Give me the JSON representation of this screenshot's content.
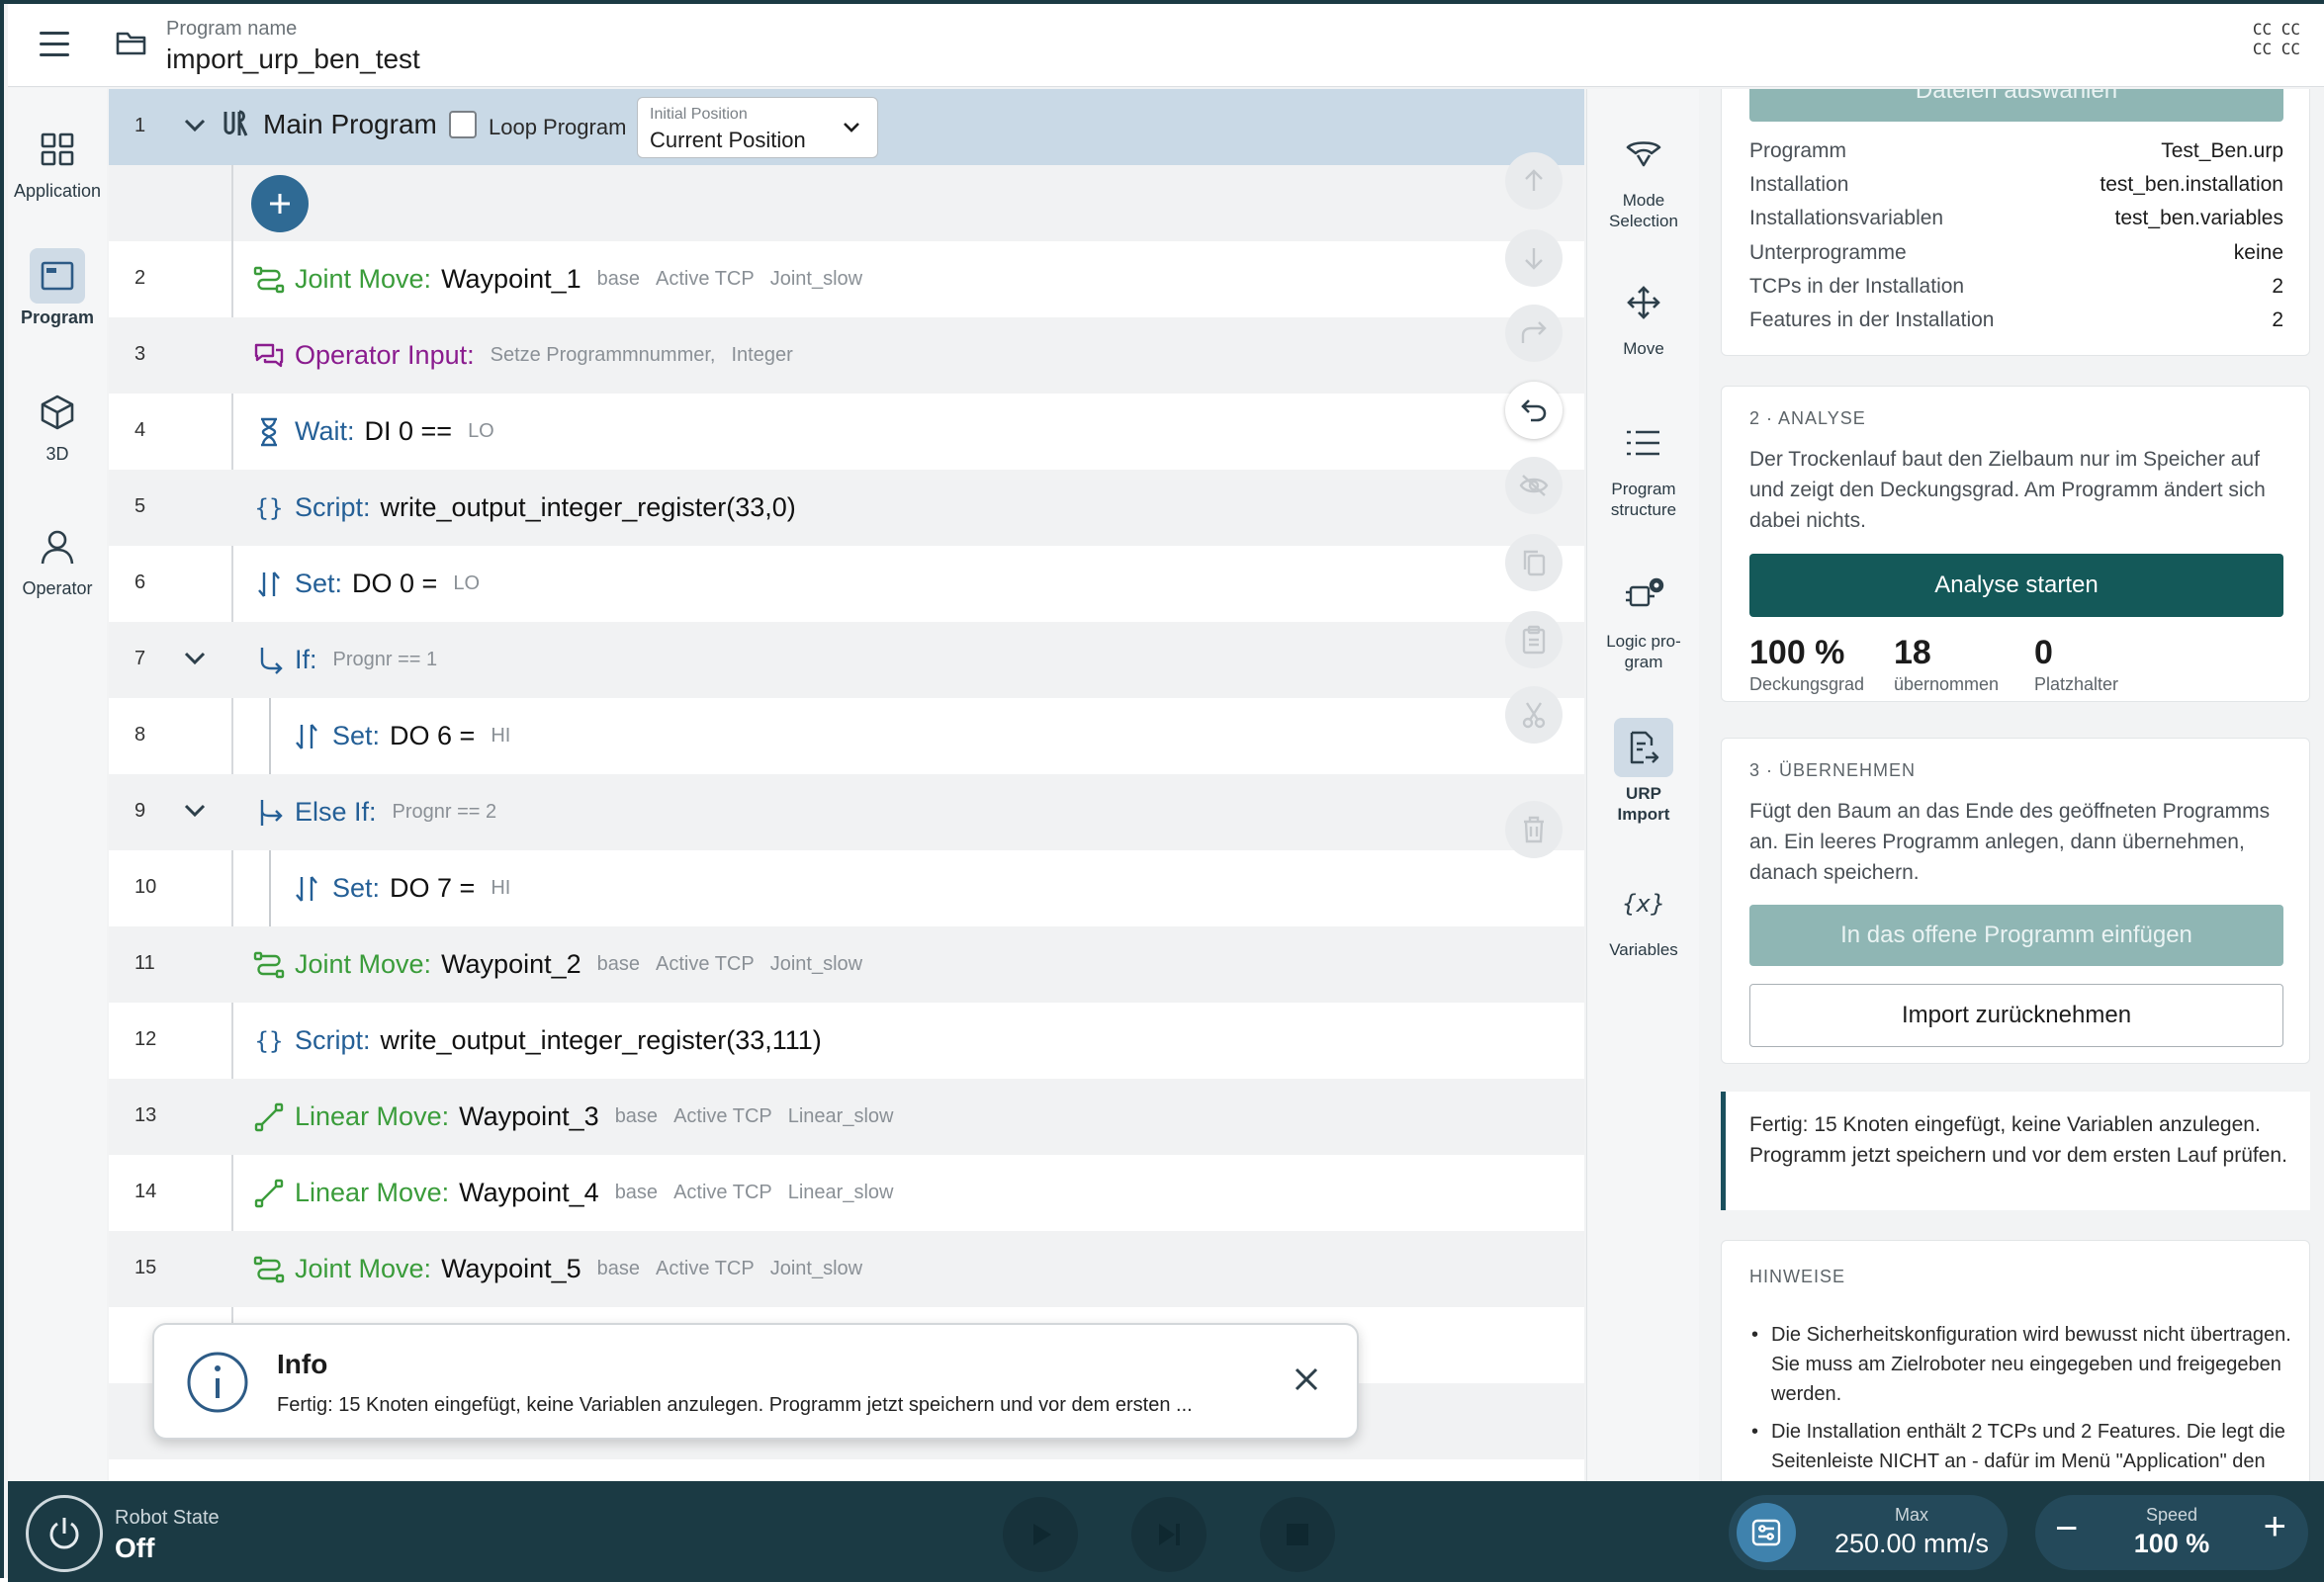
{
  "header": {
    "program_caption": "Program name",
    "program_name": "import_urp_ben_test",
    "cc_line1": "CC CC",
    "cc_line2": "CC CC"
  },
  "leftnav": {
    "items": [
      {
        "label": "Application",
        "icon": "grid-icon"
      },
      {
        "label": "Program",
        "icon": "program-window-icon"
      },
      {
        "label": "3D",
        "icon": "cube-icon"
      },
      {
        "label": "Operator",
        "icon": "person-icon"
      }
    ],
    "active": "Program"
  },
  "tree": {
    "main": {
      "num": "1",
      "title": "Main Program",
      "loop_label": "Loop Program",
      "loop_checked": false,
      "initial_position_caption": "Initial Position",
      "initial_position_value": "Current Position"
    },
    "rows": [
      {
        "num": "2",
        "kind": "joint",
        "kw": "Joint Move:",
        "val": "Waypoint_1",
        "meta": [
          "base",
          "Active TCP",
          "Joint_slow"
        ]
      },
      {
        "num": "3",
        "kind": "operator",
        "kw": "Operator Input:",
        "val": "",
        "meta": [
          "Setze Programmnummer,",
          "Integer"
        ]
      },
      {
        "num": "4",
        "kind": "wait",
        "kw": "Wait:",
        "val": "DI 0 ==",
        "meta": [
          "LO"
        ]
      },
      {
        "num": "5",
        "kind": "script",
        "kw": "Script:",
        "val": "write_output_integer_register(33,0)",
        "meta": []
      },
      {
        "num": "6",
        "kind": "set",
        "kw": "Set:",
        "val": "DO 0 =",
        "meta": [
          "LO"
        ]
      },
      {
        "num": "7",
        "kind": "if",
        "kw": "If:",
        "val": "",
        "meta": [
          "Prognr == 1"
        ]
      },
      {
        "num": "8",
        "kind": "set",
        "kw": "Set:",
        "val": "DO 6 =",
        "meta": [
          "HI"
        ]
      },
      {
        "num": "9",
        "kind": "elseif",
        "kw": "Else If:",
        "val": "",
        "meta": [
          "Prognr == 2"
        ]
      },
      {
        "num": "10",
        "kind": "set",
        "kw": "Set:",
        "val": "DO 7 =",
        "meta": [
          "HI"
        ]
      },
      {
        "num": "11",
        "kind": "joint",
        "kw": "Joint Move:",
        "val": "Waypoint_2",
        "meta": [
          "base",
          "Active TCP",
          "Joint_slow"
        ]
      },
      {
        "num": "12",
        "kind": "script",
        "kw": "Script:",
        "val": "write_output_integer_register(33,111)",
        "meta": []
      },
      {
        "num": "13",
        "kind": "linear",
        "kw": "Linear Move:",
        "val": "Waypoint_3",
        "meta": [
          "base",
          "Active TCP",
          "Linear_slow"
        ]
      },
      {
        "num": "14",
        "kind": "linear",
        "kw": "Linear Move:",
        "val": "Waypoint_4",
        "meta": [
          "base",
          "Active TCP",
          "Linear_slow"
        ]
      },
      {
        "num": "15",
        "kind": "joint",
        "kw": "Joint Move:",
        "val": "Waypoint_5",
        "meta": [
          "base",
          "Active TCP",
          "Joint_slow"
        ]
      }
    ]
  },
  "toast": {
    "title": "Info",
    "message": "Fertig: 15 Knoten eingefügt, keine Variablen anzulegen. Programm jetzt speichern und vor dem ersten ..."
  },
  "rail": {
    "items": [
      {
        "label": "Mode Selection",
        "icon": "mode-selection-icon"
      },
      {
        "label": "Move",
        "icon": "move-arrows-icon"
      },
      {
        "label": "Program structure",
        "icon": "list-icon"
      },
      {
        "label": "Logic pro- gram",
        "icon": "logic-program-icon"
      },
      {
        "label": "URP Import",
        "icon": "document-import-icon"
      },
      {
        "label": "Variables",
        "icon": "variables-icon"
      }
    ],
    "active": "URP Import"
  },
  "panel": {
    "select_files_button": "Dateien auswählen",
    "info": [
      {
        "k": "Programm",
        "v": "Test_Ben.urp"
      },
      {
        "k": "Installation",
        "v": "test_ben.installation"
      },
      {
        "k": "Installationsvariablen",
        "v": "test_ben.variables"
      },
      {
        "k": "Unterprogramme",
        "v": "keine"
      },
      {
        "k": "TCPs in der Installation",
        "v": "2"
      },
      {
        "k": "Features in der Installation",
        "v": "2"
      }
    ],
    "analysis": {
      "title": "2 · ANALYSE",
      "text": "Der Trockenlauf baut den Zielbaum nur im Speicher auf und zeigt den Deckungsgrad. Am Programm ändert sich dabei nichts.",
      "button": "Analyse starten",
      "stats": [
        {
          "n": "100 %",
          "l": "Deckungsgrad"
        },
        {
          "n": "18",
          "l": "übernommen"
        },
        {
          "n": "0",
          "l": "Platzhalter"
        }
      ]
    },
    "apply": {
      "title": "3 · ÜBERNEHMEN",
      "text": "Fügt den Baum an das Ende des geöffneten Programms an. Ein leeres Programm anlegen, dann übernehmen, danach speichern.",
      "insert_button": "In das offene Programm einfügen",
      "undo_button": "Import zurücknehmen"
    },
    "notice": "Fertig: 15 Knoten eingefügt, keine Variablen anzulegen. Programm jetzt speichern und vor dem ersten Lauf prüfen.",
    "hints": {
      "title": "HINWEISE",
      "items": [
        "Die Sicherheitskonfiguration wird bewusst nicht übertragen. Sie muss am Zielroboter neu eingegeben und freigegeben werden.",
        "Die Installation enthält 2 TCPs und 2 Features. Die legt die Seitenleiste NICHT an - dafür im Menü \"Application\" den Bildschirm \"URP Import\" öffnen"
      ]
    }
  },
  "bottom": {
    "robot_state_caption": "Robot State",
    "robot_state_value": "Off",
    "max_caption": "Max",
    "max_value": "250.00 mm/s",
    "speed_caption": "Speed",
    "speed_value": "100 %",
    "speed_minus": "−",
    "speed_plus": "+"
  },
  "colors": {
    "accent_dark": "#1b3a44",
    "primary_button": "#145959",
    "disabled_button": "#8fb6b4",
    "joint_green": "#3a9c3a",
    "operator_purple": "#8a1c8e",
    "logic_blue": "#245f96"
  }
}
